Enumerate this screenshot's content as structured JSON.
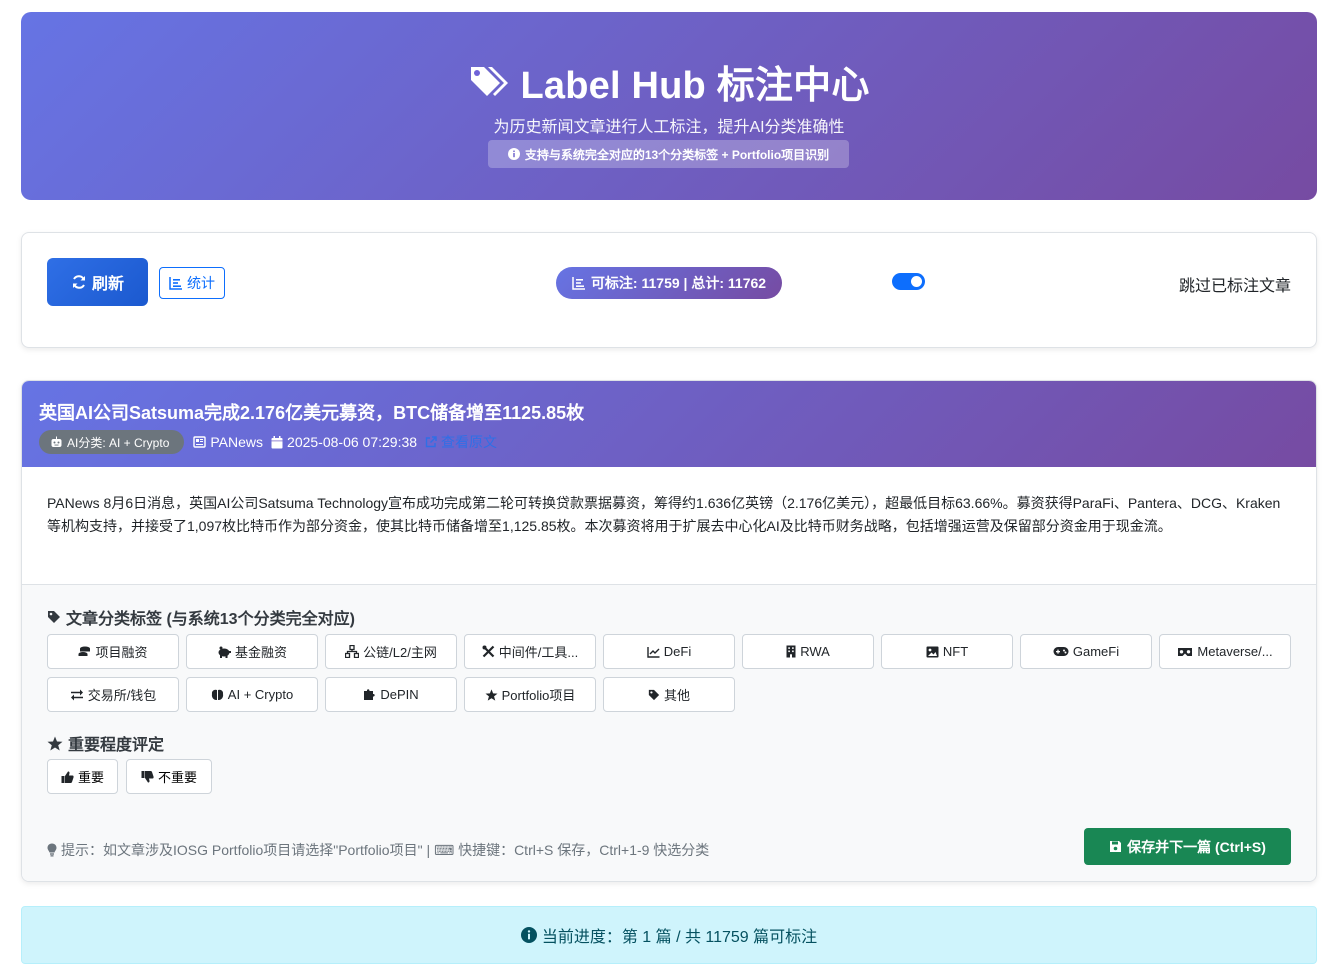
{
  "header": {
    "title": "Label Hub 标注中心",
    "subtitle": "为历史新闻文章进行人工标注，提升AI分类准确性",
    "badge": "支持与系统完全对应的13个分类标签 + Portfolio项目识别"
  },
  "toolbar": {
    "refresh_label": "刷新",
    "stats_label": "统计",
    "count_text": "可标注: 11759 | 总计: 11762",
    "skip_toggle_on": true,
    "skip_label": "跳过已标注文章"
  },
  "article": {
    "title": "英国AI公司Satsuma完成2.176亿美元募资，BTC储备增至1125.85枚",
    "ai_category": "AI分类: AI + Crypto",
    "source": "PANews",
    "datetime": "2025-08-06 07:29:38",
    "edit_label": "查看原文",
    "body": "PANews 8月6日消息，英国AI公司Satsuma Technology宣布成功完成第二轮可转换贷款票据募资，筹得约1.636亿英镑（2.176亿美元），超最低目标63.66%。募资获得ParaFi、Pantera、DCG、Kraken等机构支持，并接受了1,097枚比特币作为部分资金，使其比特币储备增至1,125.85枚。本次募资将用于扩展去中心化AI及比特币财务战略，包括增强运营及保留部分资金用于现金流。"
  },
  "categories": {
    "title": "文章分类标签 (与系统13个分类完全对应)",
    "items": [
      {
        "label": "项目融资",
        "icon": "coins-icon"
      },
      {
        "label": "基金融资",
        "icon": "piggy-bank-icon"
      },
      {
        "label": "公链/L2/主网",
        "icon": "network-icon"
      },
      {
        "label": "中间件/工具...",
        "icon": "tools-icon"
      },
      {
        "label": "DeFi",
        "icon": "chart-line-icon"
      },
      {
        "label": "RWA",
        "icon": "building-icon"
      },
      {
        "label": "NFT",
        "icon": "image-icon"
      },
      {
        "label": "GameFi",
        "icon": "gamepad-icon"
      },
      {
        "label": "Metaverse/...",
        "icon": "vr-icon"
      },
      {
        "label": "交易所/钱包",
        "icon": "exchange-icon"
      },
      {
        "label": "AI + Crypto",
        "icon": "brain-icon"
      },
      {
        "label": "DePIN",
        "icon": "puzzle-icon"
      },
      {
        "label": "Portfolio项目",
        "icon": "star-icon"
      },
      {
        "label": "其他",
        "icon": "tag-icon"
      }
    ]
  },
  "importance": {
    "title": "重要程度评定",
    "important_label": "重要",
    "unimportant_label": "不重要"
  },
  "footer": {
    "hint": "提示：如文章涉及IOSG Portfolio项目请选择\"Portfolio项目\" | ⌨ 快捷键：Ctrl+S 保存，Ctrl+1-9 快选分类",
    "save_label": "保存并下一篇 (Ctrl+S)"
  },
  "progress": {
    "text": "当前进度：第 1 篇 / 共 11759 篇可标注"
  },
  "colors": {
    "gradient_start": "#6674e4",
    "gradient_end": "#764ba2",
    "primary": "#0d6efd",
    "success": "#198754",
    "info_bg": "#cff4fc"
  }
}
